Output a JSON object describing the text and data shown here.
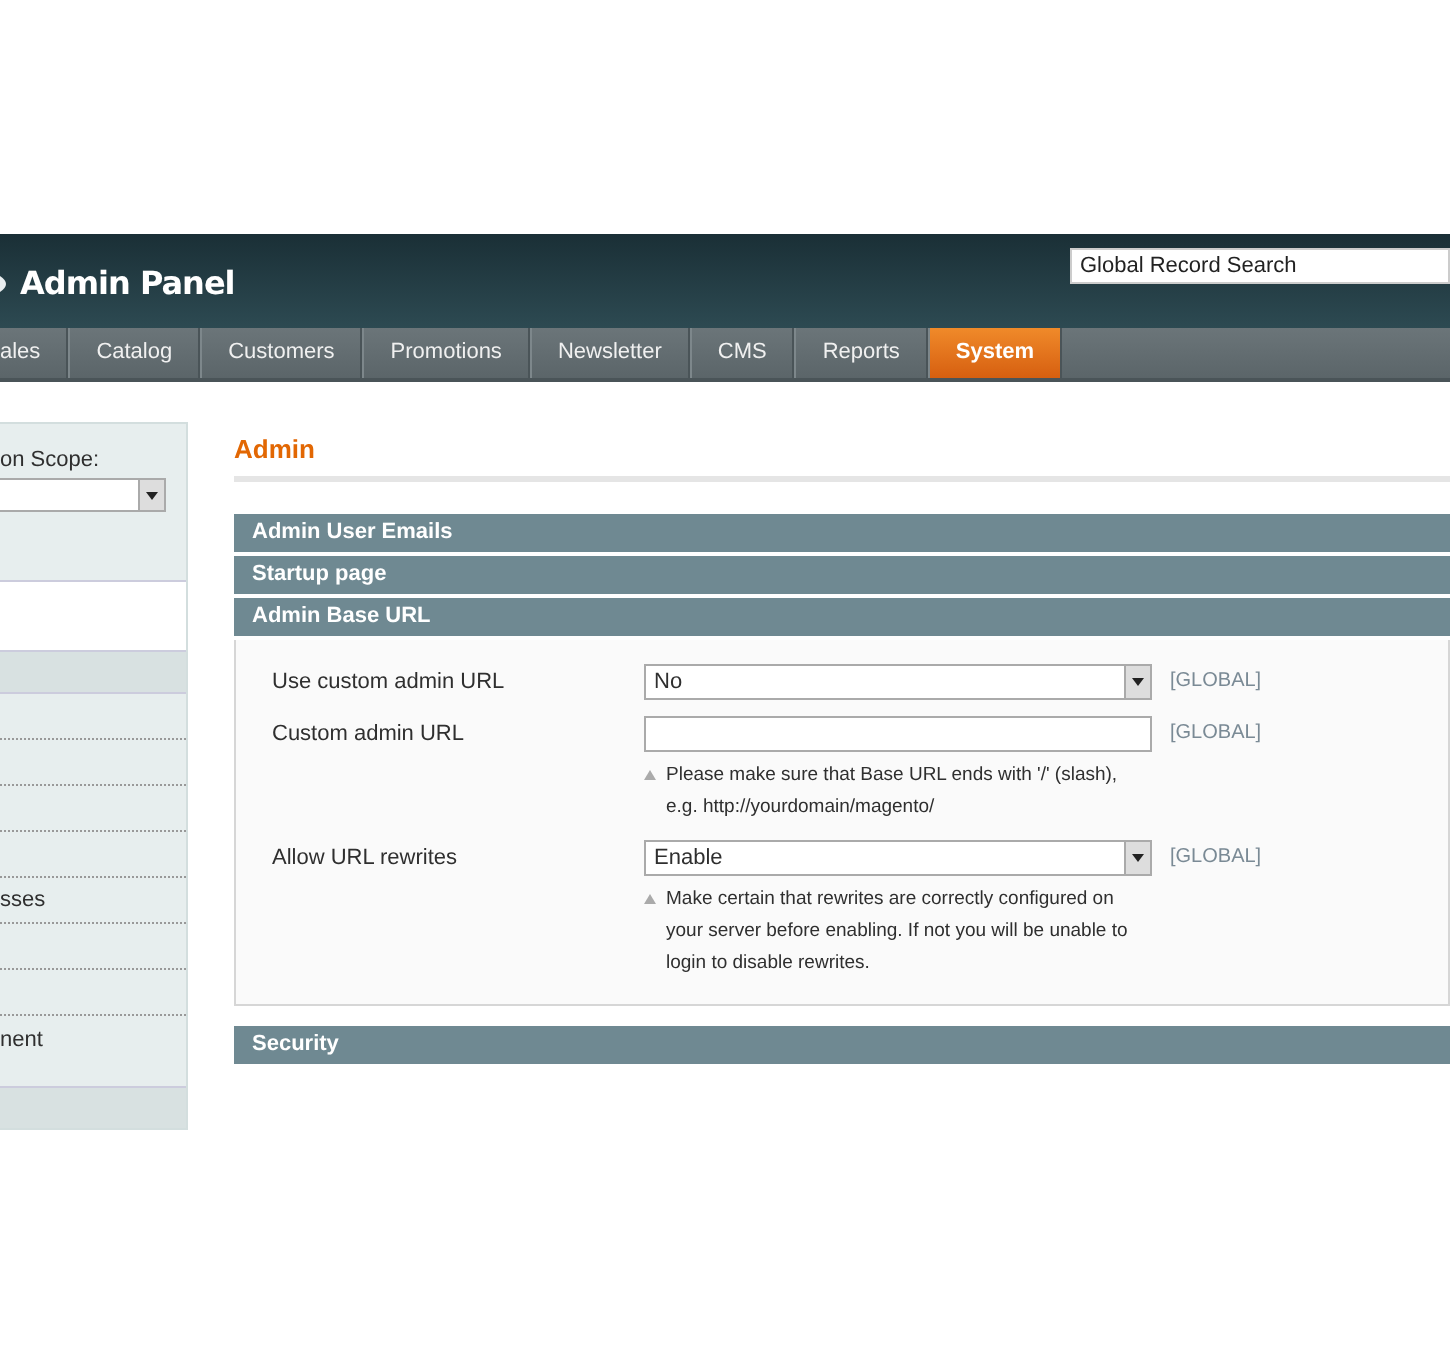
{
  "header": {
    "title": "Admin Panel",
    "search": {
      "placeholder": "Global Record Search"
    }
  },
  "nav": [
    {
      "label": "ales",
      "selected": false
    },
    {
      "label": "Catalog",
      "selected": false
    },
    {
      "label": "Customers",
      "selected": false
    },
    {
      "label": "Promotions",
      "selected": false
    },
    {
      "label": "Newsletter",
      "selected": false
    },
    {
      "label": "CMS",
      "selected": false
    },
    {
      "label": "Reports",
      "selected": false
    },
    {
      "label": "System",
      "selected": true
    }
  ],
  "sidebar": {
    "scope_label": "on Scope:",
    "items": [
      {
        "label": "sses"
      },
      {
        "label": "nent"
      }
    ]
  },
  "main": {
    "title": "Admin",
    "sections": [
      {
        "title": "Admin User Emails"
      },
      {
        "title": "Startup page"
      },
      {
        "title": "Admin Base URL",
        "fields": [
          {
            "kind": "select",
            "label": "Use custom admin URL",
            "value": "No",
            "scope": "[GLOBAL]"
          },
          {
            "kind": "text",
            "label": "Custom admin URL",
            "scope": "[GLOBAL]",
            "note": "Please make sure that Base URL ends with '/' (slash), e.g. http://yourdomain/magento/"
          },
          {
            "kind": "select",
            "label": "Allow URL rewrites",
            "value": "Enable",
            "scope": "[GLOBAL]",
            "note": "Make certain that rewrites are correctly configured on your server before enabling. If not you will be unable to login to disable rewrites."
          }
        ]
      },
      {
        "title": "Security"
      }
    ]
  }
}
